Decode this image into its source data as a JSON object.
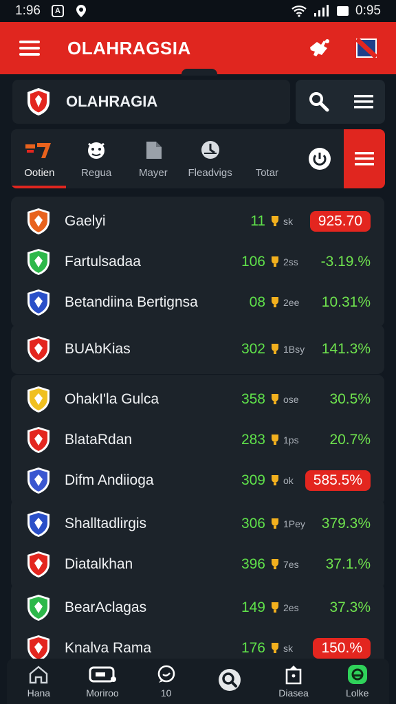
{
  "status": {
    "time_left": "1:96",
    "time_right": "0:95",
    "badge": "A"
  },
  "header": {
    "title": "OLAHRAGSIA"
  },
  "team_header": {
    "name": "OLAHRAGIA"
  },
  "tabs": [
    {
      "label": "Ootien",
      "icon": "sport-icon",
      "active": true
    },
    {
      "label": "Regua",
      "icon": "mascot-icon",
      "active": false
    },
    {
      "label": "Mayer",
      "icon": "jersey-icon",
      "active": false
    },
    {
      "label": "Fleadvigs",
      "icon": "stopwatch-icon",
      "active": false
    },
    {
      "label": "Totar",
      "icon": "",
      "active": false
    }
  ],
  "groups": [
    {
      "rows": [
        {
          "team": "Gaelyi",
          "num": "11",
          "mini": "sk",
          "value": "925.70",
          "pill": true,
          "crest": "#e8621d"
        },
        {
          "team": "Fartulsadaa",
          "num": "106",
          "mini": "2ss",
          "value": "-3.19.%",
          "pill": false,
          "crest": "#2db84a"
        },
        {
          "team": "Betandiina Bertignsa",
          "num": "08",
          "mini": "2ee",
          "value": "10.31%",
          "pill": false,
          "crest": "#2a4fc8"
        }
      ]
    },
    {
      "rows": [
        {
          "team": "BUAbKias",
          "num": "302",
          "mini": "1Bsy",
          "value": "141.3%",
          "pill": false,
          "crest": "#e3261f"
        }
      ]
    },
    {
      "rows": [
        {
          "team": "OhakI'la Gulca",
          "num": "358",
          "mini": "ose",
          "value": "30.5%",
          "pill": false,
          "crest": "#f0c020"
        },
        {
          "team": "BlataRdan",
          "num": "283",
          "mini": "1ps",
          "value": "20.7%",
          "pill": false,
          "crest": "#e3261f"
        },
        {
          "team": "Difm Andiioga",
          "num": "309",
          "mini": "ok",
          "value": "585.5%",
          "pill": true,
          "crest": "#3a56d0"
        }
      ]
    },
    {
      "rows": [
        {
          "team": "Shalltadlirgis",
          "num": "306",
          "mini": "1Pey",
          "value": "379.3%",
          "pill": false,
          "crest": "#2a4fc8"
        },
        {
          "team": "Diatalkhan",
          "num": "396",
          "mini": "7es",
          "value": "37.1.%",
          "pill": false,
          "crest": "#e3261f"
        }
      ]
    },
    {
      "rows": [
        {
          "team": "BearAclagas",
          "num": "149",
          "mini": "2es",
          "value": "37.3%",
          "pill": false,
          "crest": "#2db84a"
        },
        {
          "team": "Knalva Rama",
          "num": "176",
          "mini": "sk",
          "value": "150.%",
          "pill": true,
          "crest": "#e3261f"
        }
      ]
    }
  ],
  "bottom_nav": [
    {
      "label": "Hana",
      "icon": "home-icon"
    },
    {
      "label": "Moriroo",
      "icon": "match-icon"
    },
    {
      "label": "10",
      "icon": "chat-icon"
    },
    {
      "label": "",
      "icon": "search-icon"
    },
    {
      "label": "Diasea",
      "icon": "bag-icon"
    },
    {
      "label": "Lolke",
      "icon": "profile-icon"
    }
  ],
  "colors": {
    "accent": "#e0261f",
    "positive": "#5fe14a",
    "background": "#111820",
    "card": "#1c232a"
  }
}
